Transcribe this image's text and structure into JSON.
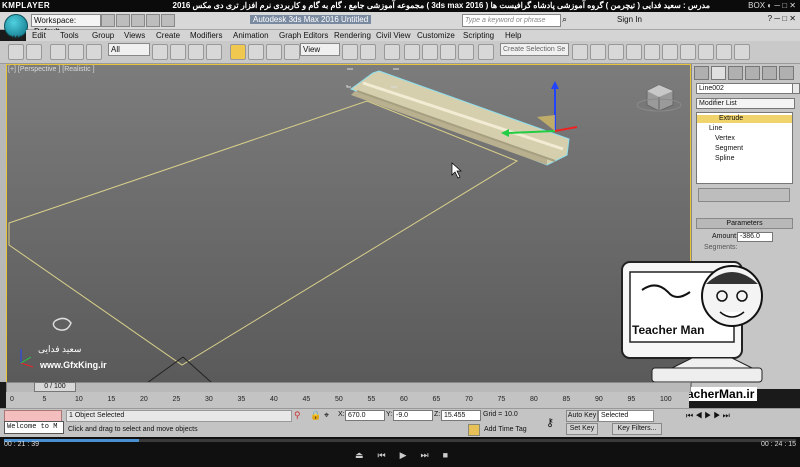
{
  "player": {
    "logo": "KMPLAYER",
    "title": "مجموعه آموزشی جامع ، گام به گام و کاربردی نرم افزار تری دی مکس 2016 ( 3ds max 2016 )  مدرس : سعید فدایی ( تیچرمن ) گروه آموزشی پادشاه گرافیست ها",
    "controls": "BOX ◐ ─ □ ✕",
    "time_current": "00 : 21 : 39",
    "time_total": "00 : 24 : 15",
    "progress": 0.17
  },
  "max": {
    "logo_text": "MAX",
    "workspace": "Workspace: Default",
    "app_title": "Autodesk 3ds Max 2016    Untitled",
    "search_placeholder": "Type a keyword or phrase",
    "sign_in": "Sign In",
    "window_buttons": "? ─ □ ✕"
  },
  "menu": [
    "Edit",
    "Tools",
    "Group",
    "Views",
    "Create",
    "Modifiers",
    "Animation",
    "Graph Editors",
    "Rendering",
    "Civil View",
    "Customize",
    "Scripting",
    "Help"
  ],
  "toolbar": {
    "selection_filter": "All",
    "reference_coord": "View",
    "named_selection_placeholder": "Create Selection Se"
  },
  "viewport": {
    "label": "[+] [Perspective ] [Realistic ]",
    "watermark_name": "سعید فدایی",
    "watermark_site": "www.GfxKing.ir"
  },
  "command_panel": {
    "object_name": "Line002",
    "modifier_list": "Modifier List",
    "stack": [
      "Extrude",
      "Line",
      "Vertex",
      "Segment",
      "Spline"
    ],
    "parameters_header": "Parameters",
    "amount_label": "Amount:",
    "amount_value": "-386.0",
    "segments_label": "Segments:"
  },
  "timeline": {
    "frame_label": "0 / 100",
    "ticks": [
      "0",
      "5",
      "10",
      "15",
      "20",
      "25",
      "30",
      "35",
      "40",
      "45",
      "50",
      "55",
      "60",
      "65",
      "70",
      "75",
      "80",
      "85",
      "90",
      "95",
      "100"
    ]
  },
  "status": {
    "maxscript": "Welcome to M",
    "selection": "1 Object Selected",
    "prompt": "Click and drag to select and move objects",
    "x_label": "X:",
    "x_value": "670.0",
    "y_label": "Y:",
    "y_value": "-9.0",
    "z_label": "Z:",
    "z_value": "15.455",
    "grid": "Grid = 10.0",
    "add_time_tag": "Add Time Tag",
    "auto_key": "Auto Key",
    "set_key": "Set Key",
    "selected": "Selected",
    "key_filters": "Key Filters..."
  },
  "overlay": {
    "teacher_name": "Teacher Man",
    "url": "www.TeacherMan.ir"
  }
}
